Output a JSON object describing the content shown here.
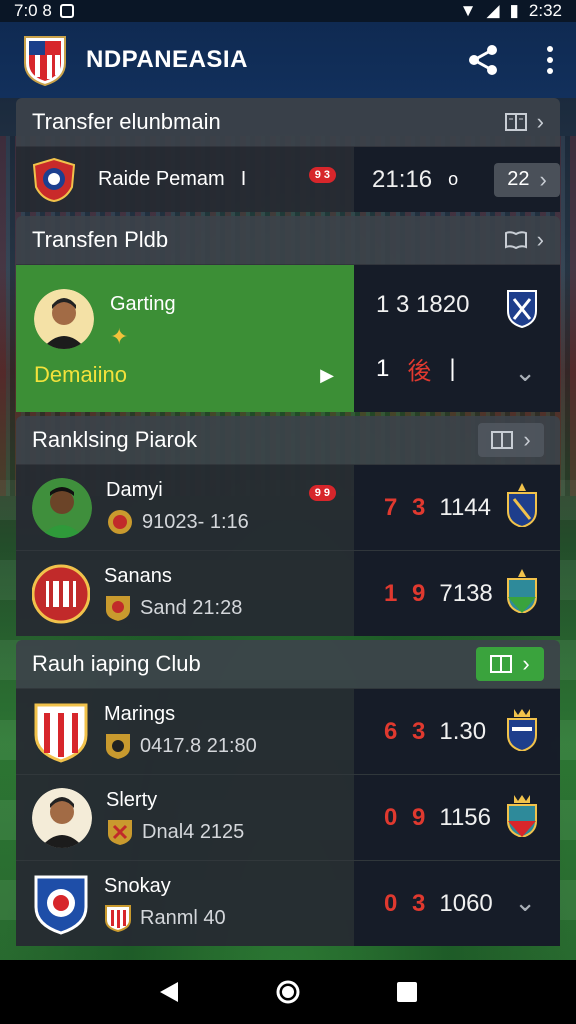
{
  "status": {
    "time_left": "7:0 8",
    "time_right": "2:32"
  },
  "app": {
    "title": "NDPANEASIA"
  },
  "sections": [
    {
      "title": "Transfer elunbmain",
      "rows": [
        {
          "name": "Raide Pemam",
          "extra": "I",
          "badge": "9 3",
          "score": "21:16",
          "dot": "o",
          "button_text": "22"
        }
      ]
    },
    {
      "title": "Transfen Pldb",
      "rows": [
        {
          "name": "Garting",
          "status_text": "Demaiino",
          "score_top": "1 3 1820",
          "score_bottom": "1",
          "score_bottom_red": "後",
          "score_bottom_extra": "|"
        }
      ]
    },
    {
      "title": "Ranklsing Piarok",
      "rows": [
        {
          "name": "Damyi",
          "sub": "91023-  1:16",
          "badge": "9 9",
          "score_red": "7 3",
          "score": "1144"
        },
        {
          "name": "Sanans",
          "sub": "Sand  21:28",
          "score_red": "1 9",
          "score": "7138"
        }
      ]
    },
    {
      "title": "Rauh iaping Club",
      "rows": [
        {
          "name": "Marings",
          "sub": "0417.8  21:80",
          "score_red": "6 3",
          "score": "1.30"
        },
        {
          "name": "Slerty",
          "sub": "Dnal4  2125",
          "score_red": "0 9",
          "score": "1156"
        },
        {
          "name": "Snokay",
          "sub": "Ranml  40",
          "score_red": "0 3",
          "score": "1060"
        }
      ]
    }
  ],
  "colors": {
    "accent_green": "#3aa33d",
    "score_red": "#e0392f",
    "app_bar": "#0f2a52"
  }
}
